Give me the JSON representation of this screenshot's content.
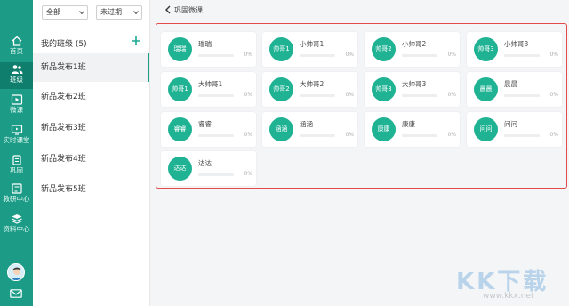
{
  "nav": {
    "items": [
      {
        "label": "首页",
        "icon": "home-icon"
      },
      {
        "label": "班级",
        "icon": "users-icon"
      },
      {
        "label": "微课",
        "icon": "play-icon"
      },
      {
        "label": "实时课堂",
        "icon": "live-classroom-icon"
      },
      {
        "label": "巩固",
        "icon": "consolidate-icon"
      },
      {
        "label": "教研中心",
        "icon": "research-icon"
      },
      {
        "label": "资料中心",
        "icon": "resources-icon"
      }
    ],
    "active": "班级",
    "avatar_icon": "user-avatar-icon",
    "mail_icon": "mail-icon"
  },
  "filters": {
    "grade": "全部",
    "status": "未过期"
  },
  "classes": {
    "header": "我的班级 (5)",
    "add_icon": "plus-icon",
    "items": [
      "新品发布1班",
      "新品发布2班",
      "新品发布3班",
      "新品发布4班",
      "新品发布5班"
    ],
    "active_index": 0
  },
  "breadcrumb": {
    "back_icon": "chevron-left-icon",
    "title": "巩固微课"
  },
  "students": [
    {
      "avatar": "瑞瑞",
      "name": "瑞瑞",
      "percent": "0%",
      "progress": 0
    },
    {
      "avatar": "帅哥1",
      "name": "小帅哥1",
      "percent": "0%",
      "progress": 0
    },
    {
      "avatar": "帅哥2",
      "name": "小帅哥2",
      "percent": "0%",
      "progress": 0
    },
    {
      "avatar": "帅哥3",
      "name": "小帅哥3",
      "percent": "0%",
      "progress": 0
    },
    {
      "avatar": "帅哥1",
      "name": "大帅哥1",
      "percent": "0%",
      "progress": 0
    },
    {
      "avatar": "帅哥2",
      "name": "大帅哥2",
      "percent": "0%",
      "progress": 0
    },
    {
      "avatar": "帅哥3",
      "name": "大帅哥3",
      "percent": "0%",
      "progress": 0
    },
    {
      "avatar": "晨晨",
      "name": "晨晨",
      "percent": "0%",
      "progress": 0
    },
    {
      "avatar": "睿睿",
      "name": "睿睿",
      "percent": "0%",
      "progress": 0
    },
    {
      "avatar": "涵涵",
      "name": "涵涵",
      "percent": "0%",
      "progress": 0
    },
    {
      "avatar": "康康",
      "name": "康康",
      "percent": "0%",
      "progress": 0
    },
    {
      "avatar": "问问",
      "name": "问问",
      "percent": "0%",
      "progress": 0
    },
    {
      "avatar": "达达",
      "name": "达达",
      "percent": "0%",
      "progress": 0
    }
  ],
  "watermark": {
    "text": "KK下载",
    "url": "www.kkx.net"
  },
  "colors": {
    "brand": "#1c9c87",
    "avatar": "#1fb394",
    "highlight_frame": "#e34b4b"
  }
}
